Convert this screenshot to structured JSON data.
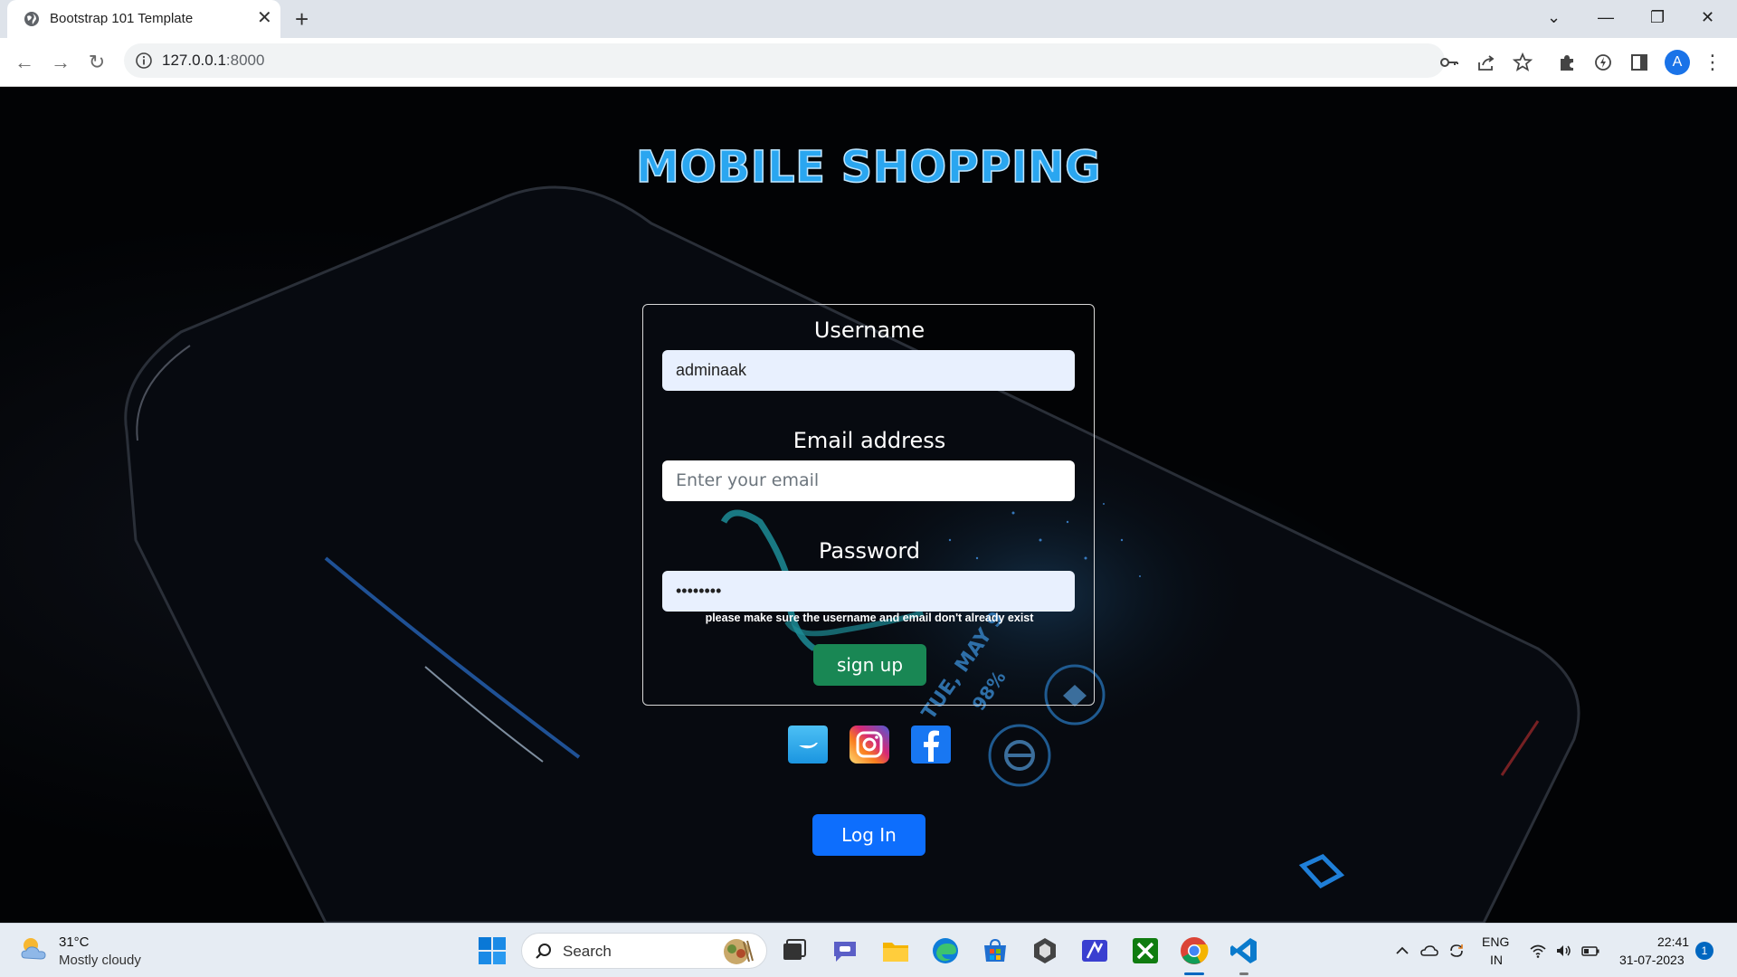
{
  "browser": {
    "tab_title": "Bootstrap 101 Template",
    "url_host": "127.0.0.1",
    "url_port": ":8000",
    "profile_initial": "A"
  },
  "page": {
    "title": "MOBILE SHOPPING",
    "username_label": "Username",
    "username_value": "adminaak",
    "email_label": "Email address",
    "email_placeholder": "Enter your email",
    "password_label": "Password",
    "password_value": "adminaak",
    "help_text": "please make sure the username and email don't already exist",
    "signup_label": "sign up",
    "login_label": "Log In",
    "social": [
      "twitter",
      "instagram",
      "facebook"
    ]
  },
  "taskbar": {
    "weather_temp": "31°C",
    "weather_desc": "Mostly cloudy",
    "search_label": "Search",
    "lang_line1": "ENG",
    "lang_line2": "IN",
    "time": "22:41",
    "date": "31-07-2023",
    "notification_count": "1"
  },
  "colors": {
    "title_blue": "#2aa6f0",
    "signup_green": "#198754",
    "login_blue": "#0d6efd"
  }
}
